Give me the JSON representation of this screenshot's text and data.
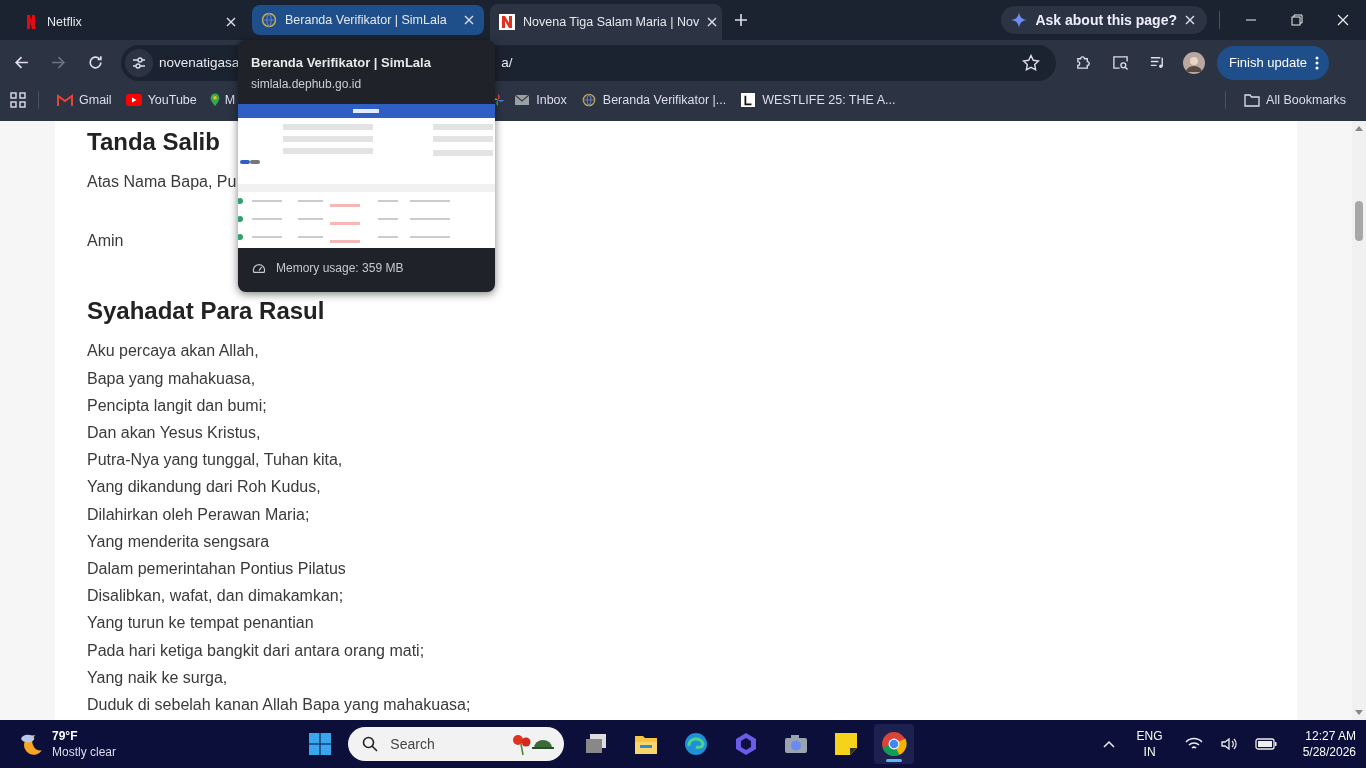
{
  "tabs": [
    {
      "title": "Netflix",
      "kind": "netflix",
      "selected": false,
      "hovered": false
    },
    {
      "title": "Beranda Verifikator | SimLala",
      "kind": "globe",
      "selected": false,
      "hovered": true
    },
    {
      "title": "Novena Tiga Salam Maria | Nov",
      "kind": "novena",
      "selected": true,
      "hovered": false
    }
  ],
  "ask_chip": "Ask about this page?",
  "address": {
    "start": "novenatigasa",
    "end": "a/"
  },
  "update_button": "Finish update",
  "bookmarks": [
    {
      "label": "Gmail",
      "kind": "gmail"
    },
    {
      "label": "YouTube",
      "kind": "youtube"
    },
    {
      "label": "M",
      "kind": "maps"
    },
    {
      "kind": "photos"
    },
    {
      "label": "Inbox",
      "kind": "mail"
    },
    {
      "label": "Beranda Verifikator |...",
      "kind": "globe"
    },
    {
      "label": "WESTLIFE 25: THE A...",
      "kind": "letter"
    }
  ],
  "all_bookmarks": "All Bookmarks",
  "tooltip": {
    "title": "Beranda Verifikator | SimLala",
    "url": "simlala.dephub.go.id",
    "memory": "Memory usage: 359 MB"
  },
  "sections": [
    {
      "heading": "Tanda Salib",
      "paragraphs": [
        [
          "Atas Nama Bapa, Pu"
        ],
        [
          "Amin"
        ]
      ]
    },
    {
      "heading": "Syahadat Para Rasul",
      "paragraphs": [
        [
          "Aku percaya akan Allah,",
          "Bapa yang mahakuasa,",
          "Pencipta langit dan bumi;",
          "Dan akan Yesus Kristus,",
          "Putra-Nya yang tunggal, Tuhan kita,",
          "Yang dikandung dari Roh Kudus,",
          "Dilahirkan oleh Perawan Maria;",
          "Yang menderita sengsara",
          "Dalam pemerintahan Pontius Pilatus",
          "Disalibkan, wafat, dan dimakamkan;",
          "Yang turun ke tempat penantian",
          "Pada hari ketiga bangkit dari antara orang mati;",
          "Yang naik ke surga,",
          "Duduk di sebelah kanan Allah Bapa yang mahakuasa;"
        ]
      ]
    }
  ],
  "taskbar": {
    "temperature": "79°F",
    "weather": "Mostly clear",
    "search_placeholder": "Search",
    "language": "ENG",
    "region": "IN",
    "time": "12:27 AM",
    "date": "5/28/2026"
  }
}
